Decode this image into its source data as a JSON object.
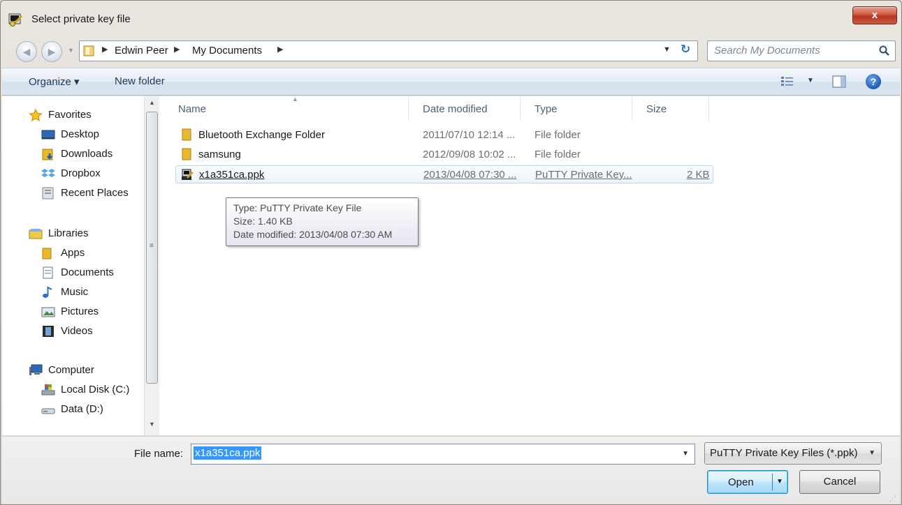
{
  "window": {
    "title": "Select private key file",
    "close_label": "x"
  },
  "address": {
    "crumbs": [
      "Edwin Peer",
      "My Documents"
    ],
    "search_placeholder": "Search My Documents"
  },
  "toolbar": {
    "organize_label": "Organize ▾",
    "new_folder_label": "New folder"
  },
  "nav": {
    "favorites": {
      "label": "Favorites",
      "items": [
        "Desktop",
        "Downloads",
        "Dropbox",
        "Recent Places"
      ]
    },
    "libraries": {
      "label": "Libraries",
      "items": [
        "Apps",
        "Documents",
        "Music",
        "Pictures",
        "Videos"
      ]
    },
    "computer": {
      "label": "Computer",
      "items": [
        "Local Disk (C:)",
        "Data (D:)"
      ]
    }
  },
  "columns": {
    "name": "Name",
    "date": "Date modified",
    "type": "Type",
    "size": "Size"
  },
  "files": [
    {
      "name": "Bluetooth Exchange Folder",
      "date": "2011/07/10 12:14 ...",
      "type": "File folder",
      "size": ""
    },
    {
      "name": "samsung",
      "date": "2012/09/08 10:02 ...",
      "type": "File folder",
      "size": ""
    },
    {
      "name": "x1a351ca.ppk",
      "date": "2013/04/08 07:30 ...",
      "type": "PuTTY Private Key...",
      "size": "2 KB"
    }
  ],
  "tooltip": {
    "type_line": "Type: PuTTY Private Key File",
    "size_line": "Size: 1.40 KB",
    "date_line": "Date modified: 2013/04/08 07:30 AM"
  },
  "bottom": {
    "file_name_label": "File name:",
    "file_name_value": "x1a351ca.ppk",
    "filter": "PuTTY Private Key Files (*.ppk)",
    "open_label": "Open",
    "cancel_label": "Cancel"
  },
  "colors": {
    "accent_blue": "#3399ff",
    "close_red": "#c9583f",
    "folder_yellow": "#e8b92c"
  }
}
